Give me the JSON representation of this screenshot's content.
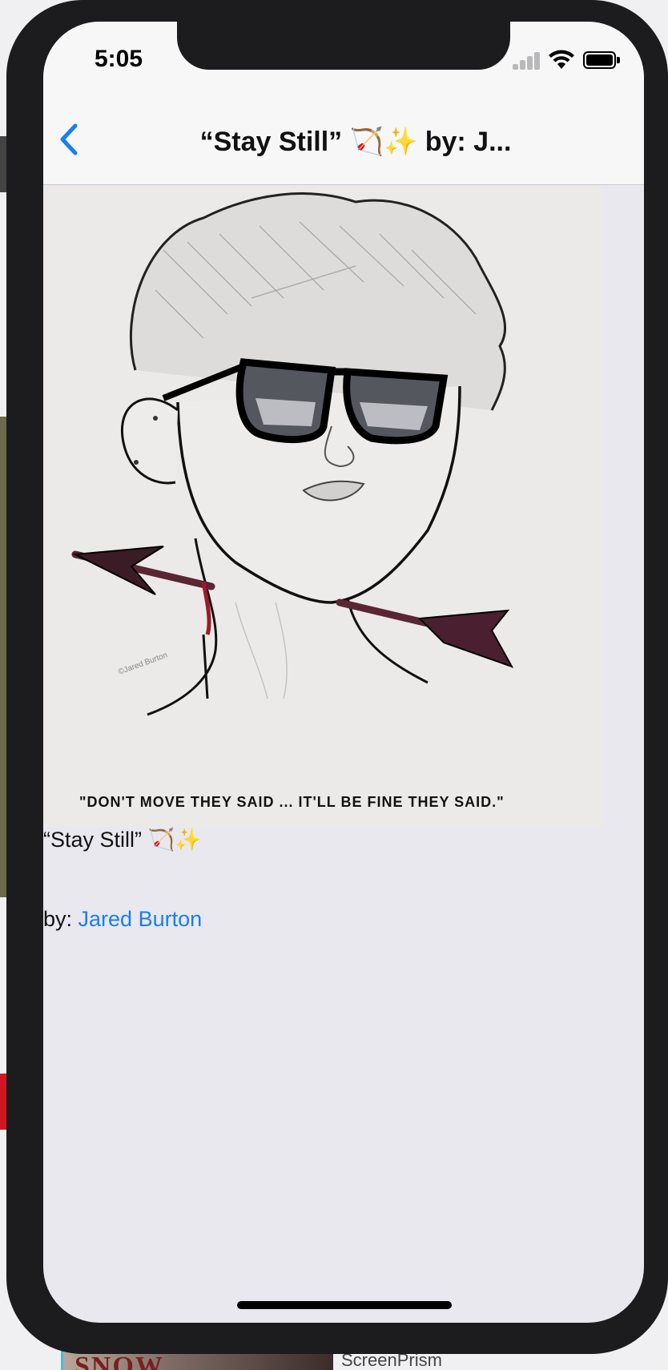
{
  "status_bar": {
    "time": "5:05"
  },
  "nav": {
    "title": "“Stay Still” 🏹✨ by: J..."
  },
  "post": {
    "artwork_quote": "\"DON'T MOVE THEY SAID ... IT'LL BE FINE THEY SAID.\"",
    "artwork_signature": "©Jared Burton",
    "caption": "“Stay Still” 🏹✨",
    "by_prefix": "by: ",
    "author": "Jared Burton"
  },
  "background_app": {
    "label": "ScreenPrism",
    "thumb_text": "SNOW"
  },
  "colors": {
    "link": "#1a7ef0",
    "nav_bg": "#f7f7f7",
    "content_bg": "#e9e8ef"
  }
}
